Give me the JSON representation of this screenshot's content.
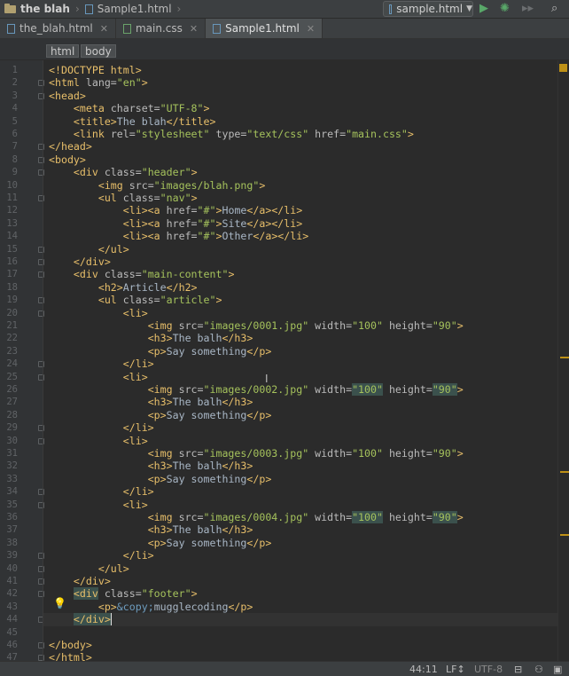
{
  "breadcrumb_bar": {
    "project": "the blah",
    "file": "Sample1.html"
  },
  "run_config": {
    "label": "sample.html"
  },
  "tabs": [
    {
      "label": "the_blah.html",
      "type": "html",
      "active": false
    },
    {
      "label": "main.css",
      "type": "css",
      "active": false
    },
    {
      "label": "Sample1.html",
      "type": "html",
      "active": true
    }
  ],
  "tag_path": [
    "html",
    "body"
  ],
  "code_lines": [
    {
      "n": "1",
      "html": "<span class='tag'>&lt;!DOCTYPE html&gt;</span>"
    },
    {
      "n": "2",
      "html": "<span class='tag'>&lt;html </span><span class='attr'>lang=</span><span class='str'>\"en\"</span><span class='tag'>&gt;</span>"
    },
    {
      "n": "3",
      "html": "<span class='tag'>&lt;head&gt;</span>"
    },
    {
      "n": "4",
      "html": "    <span class='tag'>&lt;meta </span><span class='attr'>charset=</span><span class='str'>\"UTF-8\"</span><span class='tag'>&gt;</span>"
    },
    {
      "n": "5",
      "html": "    <span class='tag'>&lt;title&gt;</span>The blah<span class='tag'>&lt;/title&gt;</span>"
    },
    {
      "n": "6",
      "html": "    <span class='tag'>&lt;link </span><span class='attr'>rel=</span><span class='str'>\"stylesheet\"</span><span class='attr'> type=</span><span class='str'>\"text/css\"</span><span class='attr'> href=</span><span class='str'>\"main.css\"</span><span class='tag'>&gt;</span>"
    },
    {
      "n": "7",
      "html": "<span class='tag'>&lt;/head&gt;</span>"
    },
    {
      "n": "8",
      "html": "<span class='tag'>&lt;body&gt;</span>"
    },
    {
      "n": "9",
      "html": "    <span class='tag'>&lt;div </span><span class='attr'>class=</span><span class='str'>\"header\"</span><span class='tag'>&gt;</span>"
    },
    {
      "n": "10",
      "html": "        <span class='tag'>&lt;img </span><span class='attr'>src=</span><span class='str'>\"images/blah.png\"</span><span class='tag'>&gt;</span>"
    },
    {
      "n": "11",
      "html": "        <span class='tag'>&lt;ul </span><span class='attr'>class=</span><span class='str'>\"nav\"</span><span class='tag'>&gt;</span>"
    },
    {
      "n": "12",
      "html": "            <span class='tag'>&lt;li&gt;&lt;a </span><span class='attr'>href=</span><span class='str'>\"#\"</span><span class='tag'>&gt;</span>Home<span class='tag'>&lt;/a&gt;&lt;/li&gt;</span>"
    },
    {
      "n": "13",
      "html": "            <span class='tag'>&lt;li&gt;&lt;a </span><span class='attr'>href=</span><span class='str'>\"#\"</span><span class='tag'>&gt;</span>Site<span class='tag'>&lt;/a&gt;&lt;/li&gt;</span>"
    },
    {
      "n": "14",
      "html": "            <span class='tag'>&lt;li&gt;&lt;a </span><span class='attr'>href=</span><span class='str'>\"#\"</span><span class='tag'>&gt;</span>Other<span class='tag'>&lt;/a&gt;&lt;/li&gt;</span>"
    },
    {
      "n": "15",
      "html": "        <span class='tag'>&lt;/ul&gt;</span>"
    },
    {
      "n": "16",
      "html": "    <span class='tag'>&lt;/div&gt;</span>"
    },
    {
      "n": "17",
      "html": "    <span class='tag'>&lt;div </span><span class='attr'>class=</span><span class='str'>\"main-content\"</span><span class='tag'>&gt;</span>"
    },
    {
      "n": "18",
      "html": "        <span class='tag'>&lt;h2&gt;</span>Article<span class='tag'>&lt;/h2&gt;</span>"
    },
    {
      "n": "19",
      "html": "        <span class='tag'>&lt;ul </span><span class='attr'>class=</span><span class='str'>\"article\"</span><span class='tag'>&gt;</span>"
    },
    {
      "n": "20",
      "html": "            <span class='tag'>&lt;li&gt;</span>"
    },
    {
      "n": "21",
      "html": "                <span class='tag'>&lt;img </span><span class='attr'>src=</span><span class='str'>\"images/0001.jpg\"</span><span class='attr'> width=</span><span class='str'>\"100\"</span><span class='attr'> height=</span><span class='str'>\"90\"</span><span class='tag'>&gt;</span>"
    },
    {
      "n": "22",
      "html": "                <span class='tag'>&lt;h3&gt;</span>The balh<span class='tag'>&lt;/h3&gt;</span>"
    },
    {
      "n": "23",
      "html": "                <span class='tag'>&lt;p&gt;</span>Say something<span class='tag'>&lt;/p&gt;</span>"
    },
    {
      "n": "24",
      "html": "            <span class='tag'>&lt;/li&gt;</span>"
    },
    {
      "n": "25",
      "html": "            <span class='tag'>&lt;li&gt;</span>"
    },
    {
      "n": "26",
      "html": "                <span class='tag'>&lt;img </span><span class='attr'>src=</span><span class='str'>\"images/0002.jpg\"</span><span class='attr'> width=</span><span class='str hl'>\"100\"</span><span class='attr'> height=</span><span class='str hl'>\"90\"</span><span class='tag'>&gt;</span>"
    },
    {
      "n": "27",
      "html": "                <span class='tag'>&lt;h3&gt;</span>The balh<span class='tag'>&lt;/h3&gt;</span>"
    },
    {
      "n": "28",
      "html": "                <span class='tag'>&lt;p&gt;</span>Say something<span class='tag'>&lt;/p&gt;</span>"
    },
    {
      "n": "29",
      "html": "            <span class='tag'>&lt;/li&gt;</span>"
    },
    {
      "n": "30",
      "html": "            <span class='tag'>&lt;li&gt;</span>"
    },
    {
      "n": "31",
      "html": "                <span class='tag'>&lt;img </span><span class='attr'>src=</span><span class='str'>\"images/0003.jpg\"</span><span class='attr'> width=</span><span class='str'>\"100\"</span><span class='attr'> height=</span><span class='str'>\"90\"</span><span class='tag'>&gt;</span>"
    },
    {
      "n": "32",
      "html": "                <span class='tag'>&lt;h3&gt;</span>The balh<span class='tag'>&lt;/h3&gt;</span>"
    },
    {
      "n": "33",
      "html": "                <span class='tag'>&lt;p&gt;</span>Say something<span class='tag'>&lt;/p&gt;</span>"
    },
    {
      "n": "34",
      "html": "            <span class='tag'>&lt;/li&gt;</span>"
    },
    {
      "n": "35",
      "html": "            <span class='tag'>&lt;li&gt;</span>"
    },
    {
      "n": "36",
      "html": "                <span class='tag'>&lt;img </span><span class='attr'>src=</span><span class='str'>\"images/0004.jpg\"</span><span class='attr'> width=</span><span class='str hl'>\"100\"</span><span class='attr'> height=</span><span class='str hl'>\"90\"</span><span class='tag'>&gt;</span>"
    },
    {
      "n": "37",
      "html": "                <span class='tag'>&lt;h3&gt;</span>The balh<span class='tag'>&lt;/h3&gt;</span>"
    },
    {
      "n": "38",
      "html": "                <span class='tag'>&lt;p&gt;</span>Say something<span class='tag'>&lt;/p&gt;</span>"
    },
    {
      "n": "39",
      "html": "            <span class='tag'>&lt;/li&gt;</span>"
    },
    {
      "n": "40",
      "html": "        <span class='tag'>&lt;/ul&gt;</span>"
    },
    {
      "n": "41",
      "html": "    <span class='tag'>&lt;/div&gt;</span>"
    },
    {
      "n": "42",
      "html": "    <span class='tag hltag'>&lt;div</span><span class='attr'> class=</span><span class='str'>\"footer\"</span><span class='tag'>&gt;</span>"
    },
    {
      "n": "43",
      "html": "        <span class='tag'>&lt;p&gt;</span><span class='ent'>&amp;copy;</span>mugglecoding<span class='tag'>&lt;/p&gt;</span>"
    },
    {
      "n": "44",
      "html": "    <span class='tag hltag'>&lt;/div&gt;</span>"
    },
    {
      "n": "45",
      "html": ""
    },
    {
      "n": "46",
      "html": "<span class='tag'>&lt;/body&gt;</span>"
    },
    {
      "n": "47",
      "html": "<span class='tag'>&lt;/html&gt;</span>"
    }
  ],
  "status": {
    "position": "44:11",
    "line_sep": "LF↕",
    "encoding": "UTF-8"
  },
  "colors": {
    "tag": "#e8bf6a",
    "string": "#a5c25c",
    "attribute": "#bababa",
    "background": "#2b2b2b"
  }
}
